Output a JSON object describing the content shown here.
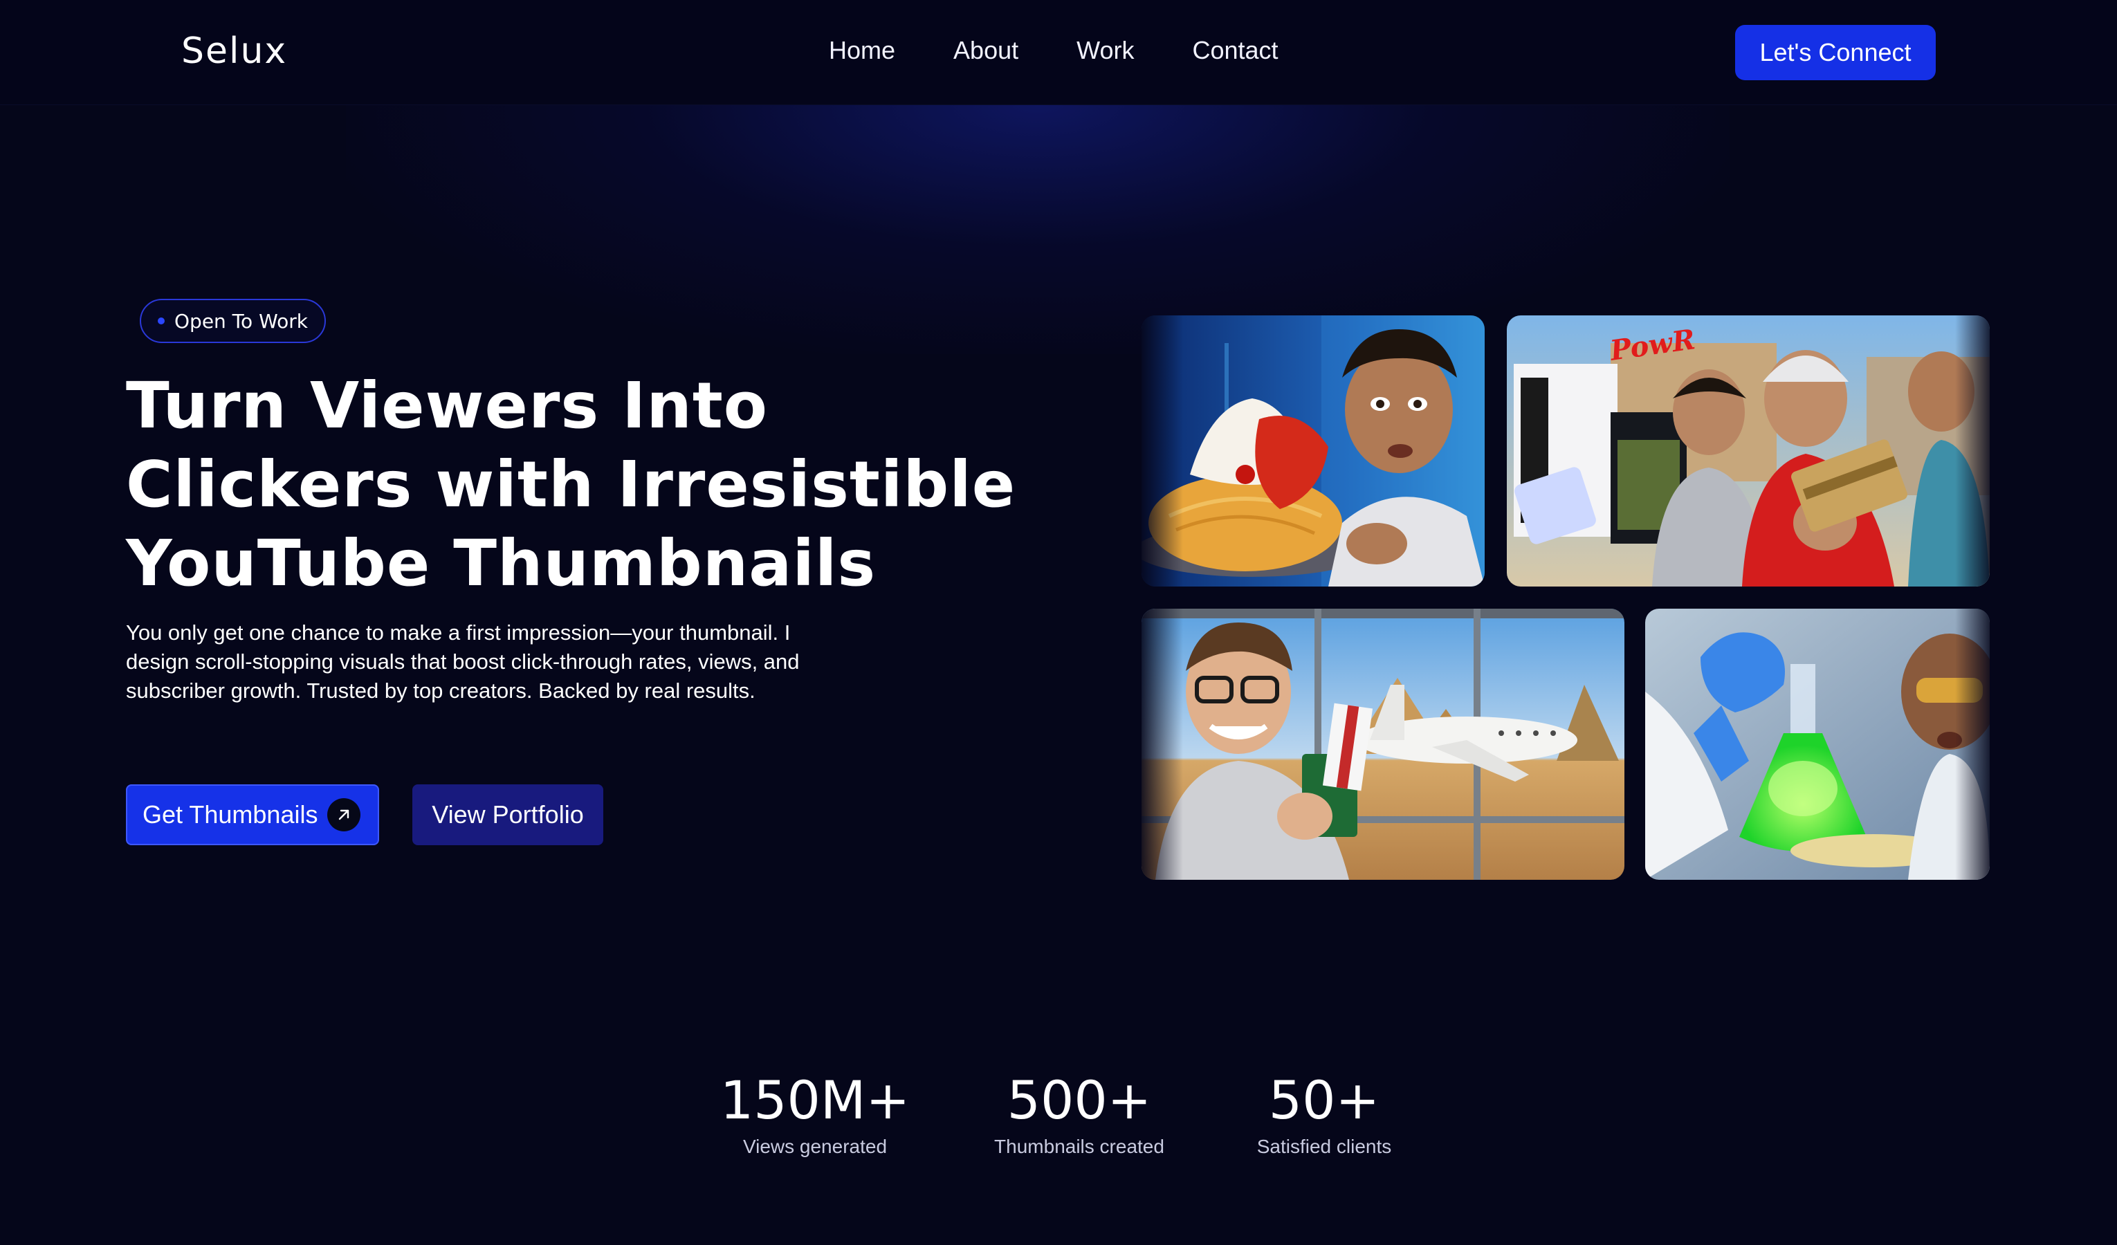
{
  "nav": {
    "logo": "Selux",
    "links": [
      "Home",
      "About",
      "Work",
      "Contact"
    ],
    "cta": "Let's Connect"
  },
  "hero": {
    "badge": "Open To Work",
    "title_lines": [
      "Turn Viewers Into",
      "Clickers with Irresistible",
      "YouTube Thumbnails"
    ],
    "description": "You only get one chance to make a first impression—your thumbnail. I design scroll-stopping visuals that boost click-through rates, views, and subscriber growth. Trusted by top creators. Backed by real results.",
    "primary_button": "Get Thumbnails",
    "secondary_button": "View Portfolio"
  },
  "thumbnails": {
    "items": [
      {
        "name": "food-challenge-thumbnail"
      },
      {
        "name": "gadget-giveaway-thumbnail",
        "overlay_text": "PowR"
      },
      {
        "name": "travel-egypt-thumbnail"
      },
      {
        "name": "science-experiment-thumbnail"
      }
    ]
  },
  "stats": [
    {
      "value": "150M+",
      "label": "Views generated"
    },
    {
      "value": "500+",
      "label": "Thumbnails created"
    },
    {
      "value": "50+",
      "label": "Satisfied clients"
    }
  ],
  "colors": {
    "background": "#05061a",
    "accent": "#1530e6",
    "secondary_button": "#181a7e"
  }
}
